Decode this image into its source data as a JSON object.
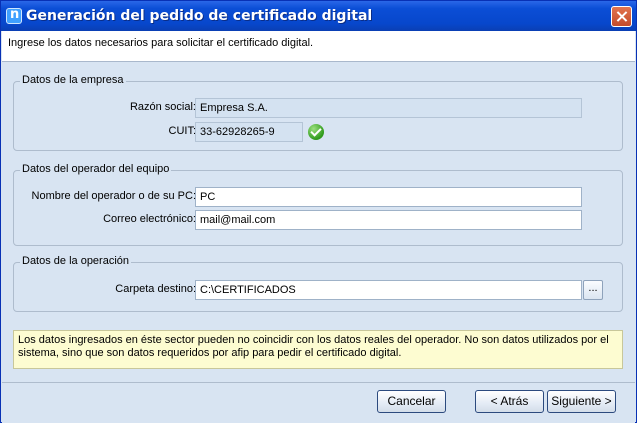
{
  "window": {
    "title": "Generación del pedido de certificado digital",
    "icon": "app-icon",
    "close_icon": "close-icon"
  },
  "header": {
    "instruction": "Ingrese los datos necesarios para solicitar el certificado digital."
  },
  "empresa": {
    "legend": "Datos de la empresa",
    "razon_social_label": "Razón social:",
    "razon_social_value": "Empresa S.A.",
    "cuit_label": "CUIT:",
    "cuit_value": "33-62928265-9",
    "cuit_status_icon": "valid-check-icon"
  },
  "operador": {
    "legend": "Datos del operador del equipo",
    "nombre_label": "Nombre del operador o de su PC:",
    "nombre_value": "PC",
    "correo_label": "Correo electrónico:",
    "correo_value": "mail@mail.com"
  },
  "operacion": {
    "legend": "Datos de la operación",
    "carpeta_label": "Carpeta destino:",
    "carpeta_value": "C:\\CERTIFICADOS",
    "browse_label": "..."
  },
  "notice": {
    "text": "Los datos ingresados en éste sector pueden no coincidir con los datos reales del operador. No son datos utilizados por el sistema, sino que son datos requeridos por afip para pedir el certificado digital."
  },
  "buttons": {
    "cancel": "Cancelar",
    "back": "< Atrás",
    "next": "Siguiente >"
  },
  "colors": {
    "titlebar": "#0b4ed6",
    "body": "#d8e4f2",
    "notice_bg": "#fdfcd1",
    "readonly_field": "#d4e2f1"
  }
}
